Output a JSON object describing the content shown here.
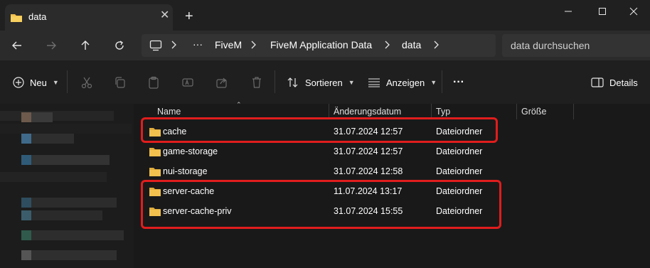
{
  "window": {
    "tab_title": "data",
    "tab_close": "✕",
    "new_tab": "+",
    "controls": [
      "minimize",
      "maximize",
      "close"
    ]
  },
  "navigation": {
    "back_icon": "arrow-left-icon",
    "forward_icon": "arrow-right-icon",
    "up_icon": "arrow-up-icon",
    "refresh_icon": "refresh-icon"
  },
  "breadcrumb": {
    "overflow": "···",
    "items": [
      "FiveM",
      "FiveM Application Data",
      "data"
    ]
  },
  "search": {
    "placeholder": "data durchsuchen"
  },
  "commandbar": {
    "new_label": "Neu",
    "sort_label": "Sortieren",
    "view_label": "Anzeigen",
    "more_label": "···",
    "details_label": "Details"
  },
  "filelist": {
    "columns": [
      "Name",
      "Änderungsdatum",
      "Typ",
      "Größe"
    ],
    "rows": [
      {
        "name": "cache",
        "date": "31.07.2024 12:57",
        "type": "Dateiordner",
        "size": ""
      },
      {
        "name": "game-storage",
        "date": "31.07.2024 12:57",
        "type": "Dateiordner",
        "size": ""
      },
      {
        "name": "nui-storage",
        "date": "31.07.2024 12:58",
        "type": "Dateiordner",
        "size": ""
      },
      {
        "name": "server-cache",
        "date": "11.07.2024 13:17",
        "type": "Dateiordner",
        "size": ""
      },
      {
        "name": "server-cache-priv",
        "date": "31.07.2024 15:55",
        "type": "Dateiordner",
        "size": ""
      }
    ]
  },
  "colors": {
    "highlight": "#e11d1d",
    "folder": "#f2c14e",
    "background": "#191919"
  }
}
